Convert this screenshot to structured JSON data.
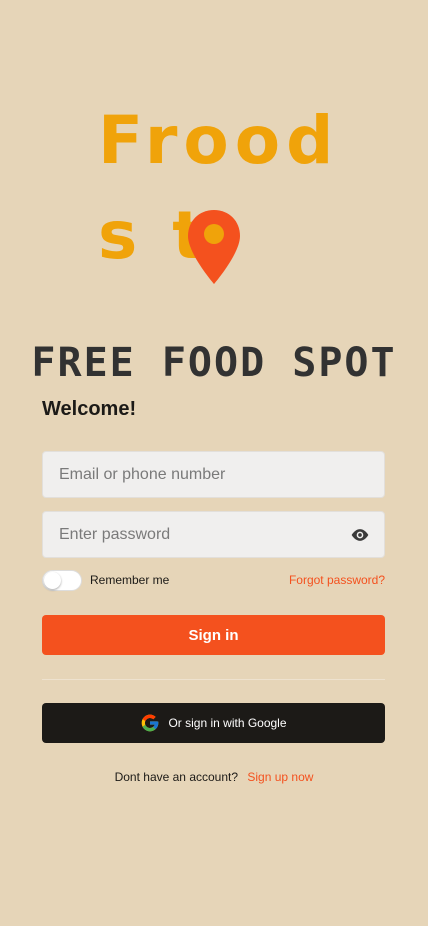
{
  "logo": {
    "line1": "Frood",
    "line2": "s  t",
    "pin_color": "#F4511E",
    "text_color": "#F0A30A"
  },
  "tagline": "FREE FOOD SPOT",
  "welcome": "Welcome!",
  "email": {
    "placeholder": "Email or phone number",
    "value": ""
  },
  "password": {
    "placeholder": "Enter password",
    "value": ""
  },
  "remember_label": "Remember me",
  "remember_checked": false,
  "forgot_label": "Forgot password?",
  "signin_label": "Sign in",
  "google_label": "Or sign in with Google",
  "signup": {
    "prompt": "Dont have an account?",
    "link": "Sign up now"
  },
  "colors": {
    "background": "#E6D5B8",
    "accent": "#F4511E",
    "dark": "#1C1A17"
  }
}
